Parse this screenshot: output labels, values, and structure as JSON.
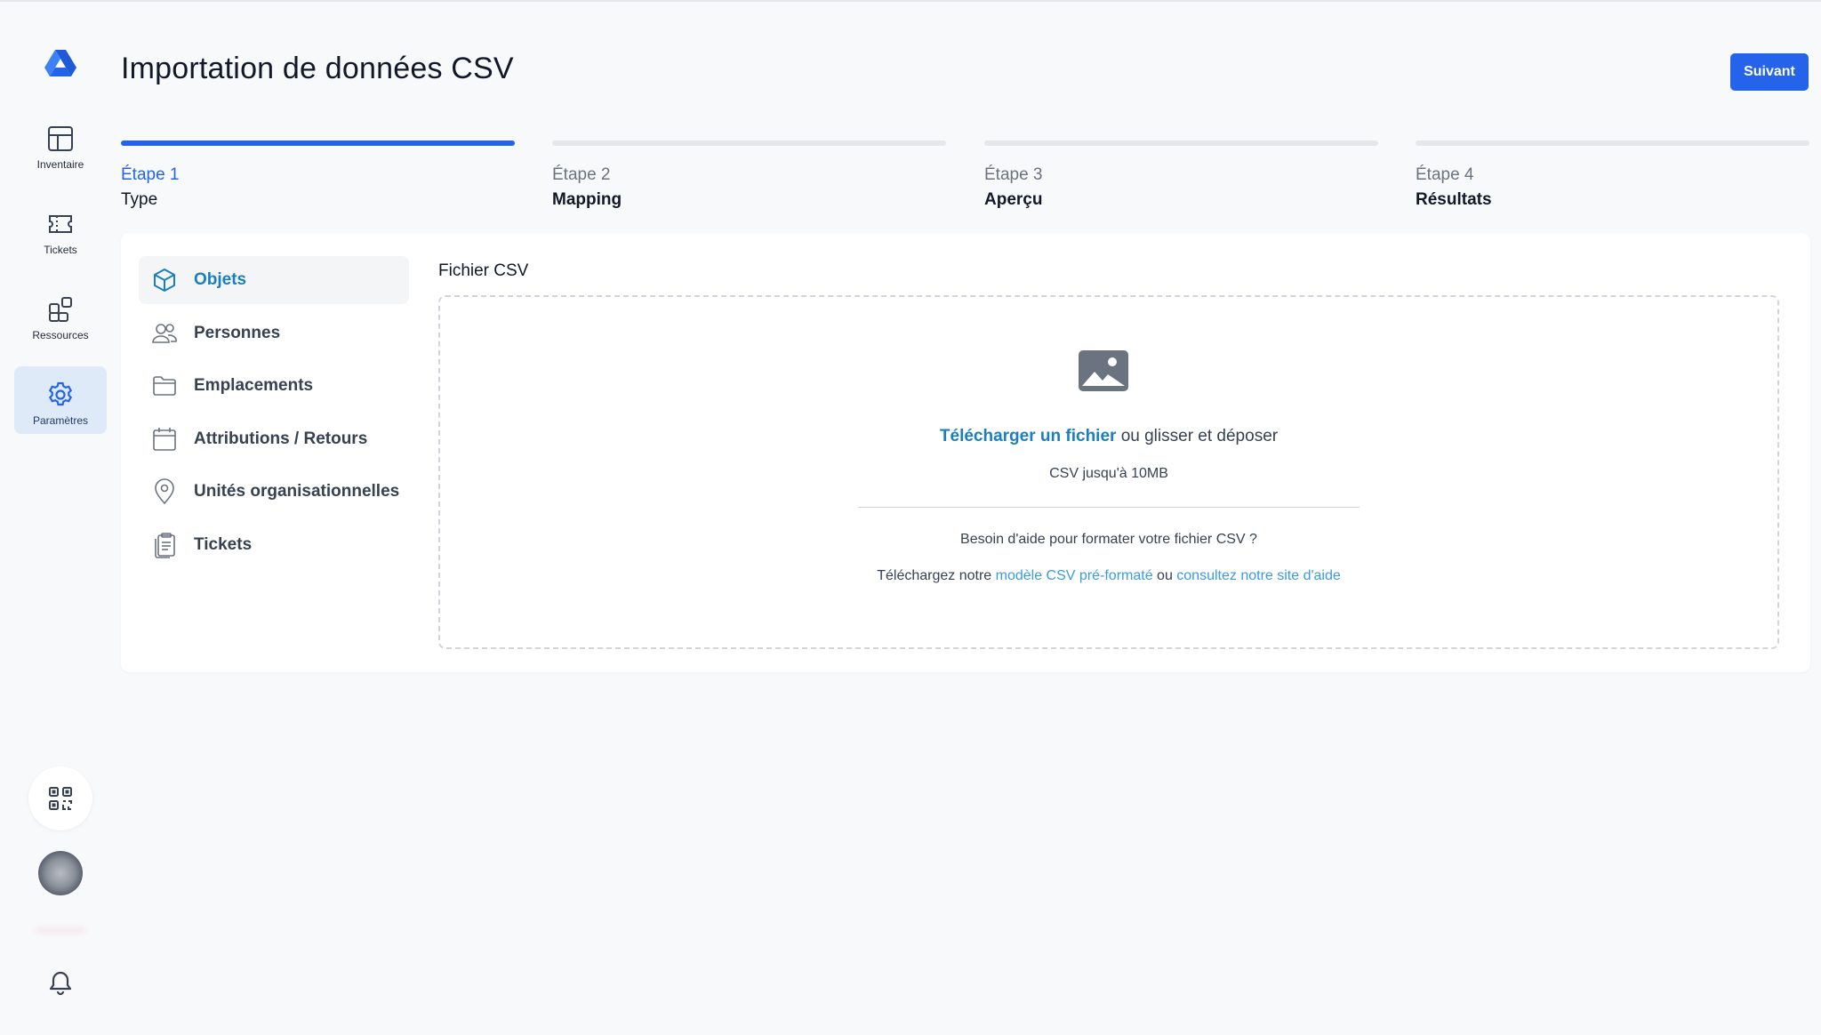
{
  "sidebar": {
    "items": [
      {
        "label": "Inventaire",
        "icon": "table-icon"
      },
      {
        "label": "Tickets",
        "icon": "ticket-icon"
      },
      {
        "label": "Ressources",
        "icon": "resources-icon"
      },
      {
        "label": "Paramètres",
        "icon": "gear-icon",
        "active": true
      }
    ],
    "user_name": "_______"
  },
  "header": {
    "title": "Importation de données CSV",
    "next_label": "Suivant"
  },
  "steps": [
    {
      "number": "Étape 1",
      "name": "Type",
      "active": true
    },
    {
      "number": "Étape 2",
      "name": "Mapping"
    },
    {
      "number": "Étape 3",
      "name": "Aperçu"
    },
    {
      "number": "Étape 4",
      "name": "Résultats"
    }
  ],
  "types": [
    {
      "label": "Objets",
      "icon": "cube-icon",
      "active": true
    },
    {
      "label": "Personnes",
      "icon": "users-icon"
    },
    {
      "label": "Emplacements",
      "icon": "folder-icon"
    },
    {
      "label": "Attributions / Retours",
      "icon": "calendar-icon"
    },
    {
      "label": "Unités organisationnelles",
      "icon": "map-pin-icon"
    },
    {
      "label": "Tickets",
      "icon": "clipboard-icon"
    }
  ],
  "upload": {
    "section_label": "Fichier CSV",
    "upload_link": "Télécharger un fichier",
    "upload_rest": " ou glisser et déposer",
    "limit": "CSV jusqu'à 10MB",
    "help_question": "Besoin d'aide pour formater votre fichier CSV ?",
    "help_prefix": "Téléchargez notre ",
    "template_link": "modèle CSV pré-formaté",
    "help_middle": " ou ",
    "help_site_link": "consultez notre site d'aide"
  },
  "colors": {
    "accent": "#2563eb",
    "link": "#1a7fc0",
    "active_nav_bg": "#dfeaf9"
  }
}
